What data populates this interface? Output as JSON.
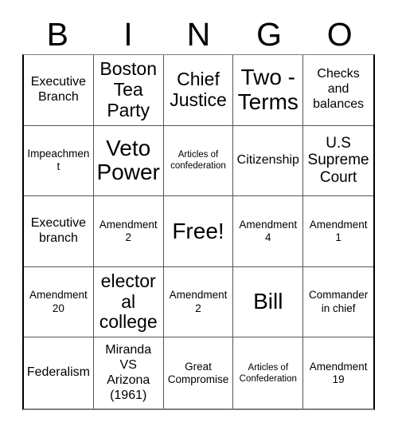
{
  "card": {
    "title": "BINGO Card",
    "header_letters": [
      "B",
      "I",
      "N",
      "G",
      "O"
    ],
    "grid_size": "5x5",
    "free_space": "Free!",
    "colors": {
      "background": "#ffffff",
      "text": "#000000",
      "grid_line": "#555555",
      "grid_border": "#000000"
    }
  },
  "rows": [
    {
      "cells": [
        {
          "text": "Executive\nBranch",
          "size": "m"
        },
        {
          "text": "Boston\nTea\nParty",
          "size": "xl"
        },
        {
          "text": "Chief\nJustice",
          "size": "xl"
        },
        {
          "text": "Two -\nTerms",
          "size": "xxl"
        },
        {
          "text": "Checks\nand\nbalances",
          "size": "m"
        }
      ]
    },
    {
      "cells": [
        {
          "text": "Impeachment",
          "size": "s"
        },
        {
          "text": "Veto\nPower",
          "size": "xxl"
        },
        {
          "text": "Articles of\nconfederation",
          "size": "xs"
        },
        {
          "text": "Citizenship",
          "size": "m"
        },
        {
          "text": "U.S\nSupreme\nCourt",
          "size": "l"
        }
      ]
    },
    {
      "cells": [
        {
          "text": "Executive\nbranch",
          "size": "m"
        },
        {
          "text": "Amendment\n2",
          "size": "s"
        },
        {
          "text": "Free!",
          "size": "xxl"
        },
        {
          "text": "Amendment\n4",
          "size": "s"
        },
        {
          "text": "Amendment\n1",
          "size": "s"
        }
      ]
    },
    {
      "cells": [
        {
          "text": "Amendment\n20",
          "size": "s"
        },
        {
          "text": "electoral\ncollege",
          "size": "xl"
        },
        {
          "text": "Amendment\n2",
          "size": "s"
        },
        {
          "text": "Bill",
          "size": "xxl"
        },
        {
          "text": "Commander\nin chief",
          "size": "s"
        }
      ]
    },
    {
      "cells": [
        {
          "text": "Federalism",
          "size": "m"
        },
        {
          "text": "Miranda\nVS\nArizona\n(1961)",
          "size": "m"
        },
        {
          "text": "Great\nCompromise",
          "size": "s"
        },
        {
          "text": "Articles of\nConfederation",
          "size": "xs"
        },
        {
          "text": "Amendment\n19",
          "size": "s"
        }
      ]
    }
  ]
}
